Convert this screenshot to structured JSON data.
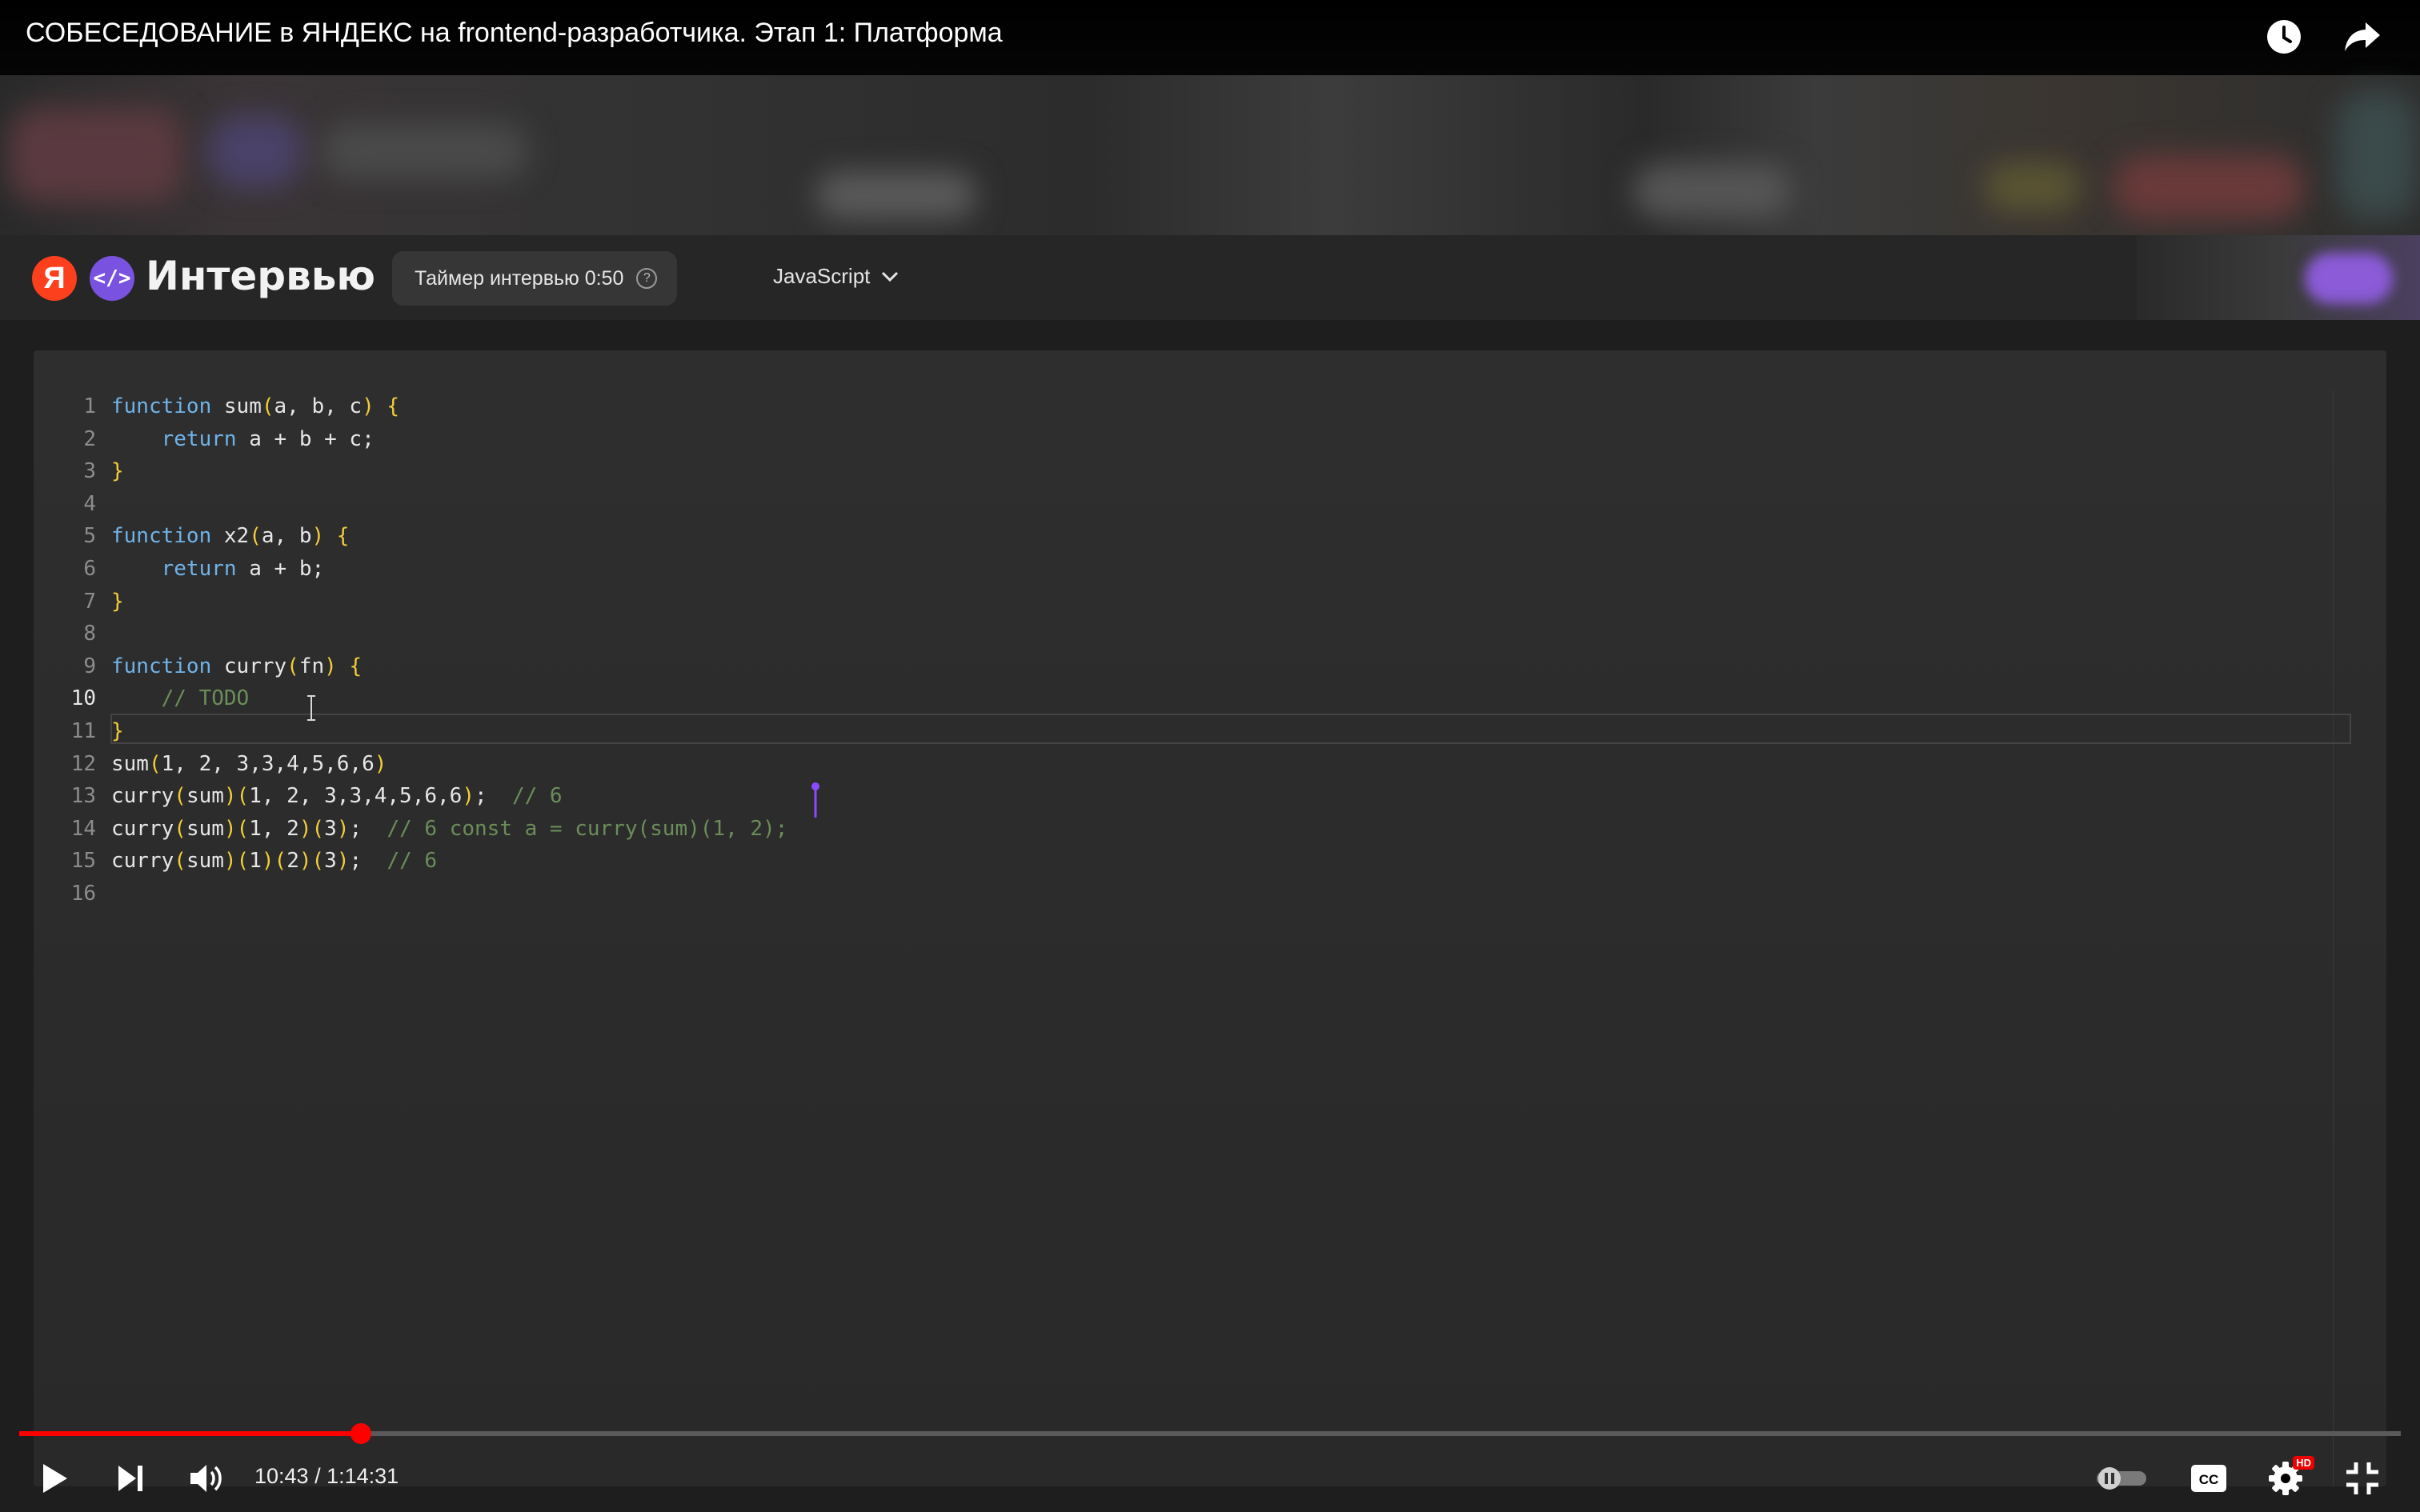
{
  "video": {
    "title": "СОБЕСЕДОВАНИЕ в ЯНДЕКС на frontend-разработчика. Этап 1: Платформа"
  },
  "app": {
    "logo_letter": "Я",
    "code_logo": "</>",
    "name": "Интервью",
    "timer_label": "Таймер интервью 0:50",
    "timer_help": "?",
    "language": "JavaScript"
  },
  "editor": {
    "active_line": 10,
    "lines": [
      {
        "n": "1",
        "tokens": [
          [
            "kw",
            "function"
          ],
          [
            "id",
            " sum"
          ],
          [
            "br",
            "("
          ],
          [
            "id",
            "a, b, c"
          ],
          [
            "br",
            ")"
          ],
          [
            "id",
            " "
          ],
          [
            "br",
            "{"
          ]
        ]
      },
      {
        "n": "2",
        "tokens": [
          [
            "id",
            "    "
          ],
          [
            "kw",
            "return"
          ],
          [
            "id",
            " a + b + c;"
          ]
        ]
      },
      {
        "n": "3",
        "tokens": [
          [
            "br",
            "}"
          ]
        ]
      },
      {
        "n": "4",
        "tokens": []
      },
      {
        "n": "5",
        "tokens": [
          [
            "kw",
            "function"
          ],
          [
            "id",
            " x2"
          ],
          [
            "br",
            "("
          ],
          [
            "id",
            "a, b"
          ],
          [
            "br",
            ")"
          ],
          [
            "id",
            " "
          ],
          [
            "br",
            "{"
          ]
        ]
      },
      {
        "n": "6",
        "tokens": [
          [
            "id",
            "    "
          ],
          [
            "kw",
            "return"
          ],
          [
            "id",
            " a + b;"
          ]
        ]
      },
      {
        "n": "7",
        "tokens": [
          [
            "br",
            "}"
          ]
        ]
      },
      {
        "n": "8",
        "tokens": []
      },
      {
        "n": "9",
        "tokens": [
          [
            "kw",
            "function"
          ],
          [
            "id",
            " curry"
          ],
          [
            "br",
            "("
          ],
          [
            "id",
            "fn"
          ],
          [
            "br",
            ")"
          ],
          [
            "id",
            " "
          ],
          [
            "br",
            "{"
          ]
        ]
      },
      {
        "n": "10",
        "tokens": [
          [
            "id",
            "    "
          ],
          [
            "cm",
            "// TODO"
          ]
        ]
      },
      {
        "n": "11",
        "tokens": [
          [
            "br",
            "}"
          ]
        ]
      },
      {
        "n": "12",
        "tokens": [
          [
            "id",
            "sum"
          ],
          [
            "br",
            "("
          ],
          [
            "id",
            "1, 2, 3,3,4,5,6,6"
          ],
          [
            "br",
            ")"
          ]
        ]
      },
      {
        "n": "13",
        "tokens": [
          [
            "id",
            "curry"
          ],
          [
            "br",
            "("
          ],
          [
            "id",
            "sum"
          ],
          [
            "br",
            ")("
          ],
          [
            "id",
            "1, 2, 3,3,4,5,6,6"
          ],
          [
            "br",
            ")"
          ],
          [
            "id",
            ";  "
          ],
          [
            "cm",
            "// 6"
          ]
        ]
      },
      {
        "n": "14",
        "tokens": [
          [
            "id",
            "curry"
          ],
          [
            "br",
            "("
          ],
          [
            "id",
            "sum"
          ],
          [
            "br",
            ")("
          ],
          [
            "id",
            "1, 2"
          ],
          [
            "br",
            ")("
          ],
          [
            "id",
            "3"
          ],
          [
            "br",
            ")"
          ],
          [
            "id",
            ";  "
          ],
          [
            "cm",
            "// 6 const a = curry(sum)(1, 2);"
          ]
        ]
      },
      {
        "n": "15",
        "tokens": [
          [
            "id",
            "curry"
          ],
          [
            "br",
            "("
          ],
          [
            "id",
            "sum"
          ],
          [
            "br",
            ")("
          ],
          [
            "id",
            "1"
          ],
          [
            "br",
            ")("
          ],
          [
            "id",
            "2"
          ],
          [
            "br",
            ")("
          ],
          [
            "id",
            "3"
          ],
          [
            "br",
            ")"
          ],
          [
            "id",
            ";  "
          ],
          [
            "cm",
            "// 6"
          ]
        ]
      },
      {
        "n": "16",
        "tokens": []
      }
    ]
  },
  "player": {
    "time": "10:43 / 1:14:31",
    "progress": 0.1436,
    "hd_badge": "HD",
    "colors": {
      "progress": "#ff0000",
      "accent_purple": "#7a52e0",
      "yandex_red": "#fc3f1d"
    }
  },
  "icons": {
    "top": [
      "clock-icon",
      "share-icon"
    ],
    "controls": [
      "play-icon",
      "next-icon",
      "volume-icon",
      "autoplay-toggle",
      "captions-icon",
      "settings-icon",
      "exit-fullscreen-icon"
    ]
  }
}
